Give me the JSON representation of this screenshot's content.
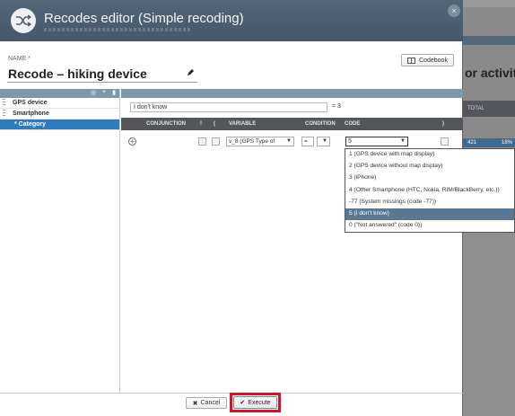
{
  "background": {
    "title_fragment": "or activity",
    "column_header": "TOTAL",
    "row_values": [
      "421",
      "18%"
    ]
  },
  "dialog": {
    "title": "Recodes editor (Simple recoding)",
    "close_glyph": "×",
    "name_label": "NAME *",
    "name_value": "Recode – hiking device",
    "codebook_label": "Codebook"
  },
  "tree": {
    "header_icons": [
      "◎",
      "+",
      "▮"
    ],
    "items": [
      {
        "label": "GPS device"
      },
      {
        "label": "Smartphone"
      },
      {
        "label": "* Category"
      }
    ]
  },
  "recode": {
    "label_value": "I don't know",
    "equals_label": "= 3",
    "columns": {
      "conjunction": "CONJUNCTION",
      "not": "!",
      "open_paren": "(",
      "variable": "VARIABLE",
      "condition": "CONDITION",
      "code": "CODE",
      "close_paren": ")"
    },
    "row": {
      "variable": "v_8 (GPS Type of",
      "condition": "=",
      "code": "5"
    }
  },
  "dropdown": {
    "options": [
      "1 (GPS device with map display)",
      "2 (GPS device without map display)",
      "3 (iPhone)",
      "4 (Other Smartphone (HTC, Nokia, RIM/BlackBerry, etc.))",
      "-77 (System missings (code -77))",
      "5 (I don't know)",
      "0 (\"Not answered\" (code 0))"
    ],
    "highlighted_index": 5
  },
  "footer": {
    "cancel_label": "Cancel",
    "execute_label": "Execute"
  },
  "colors": {
    "titlebar": "#4b5d6e",
    "selected": "#2f7bbf",
    "highlight_box": "#d4142a"
  }
}
